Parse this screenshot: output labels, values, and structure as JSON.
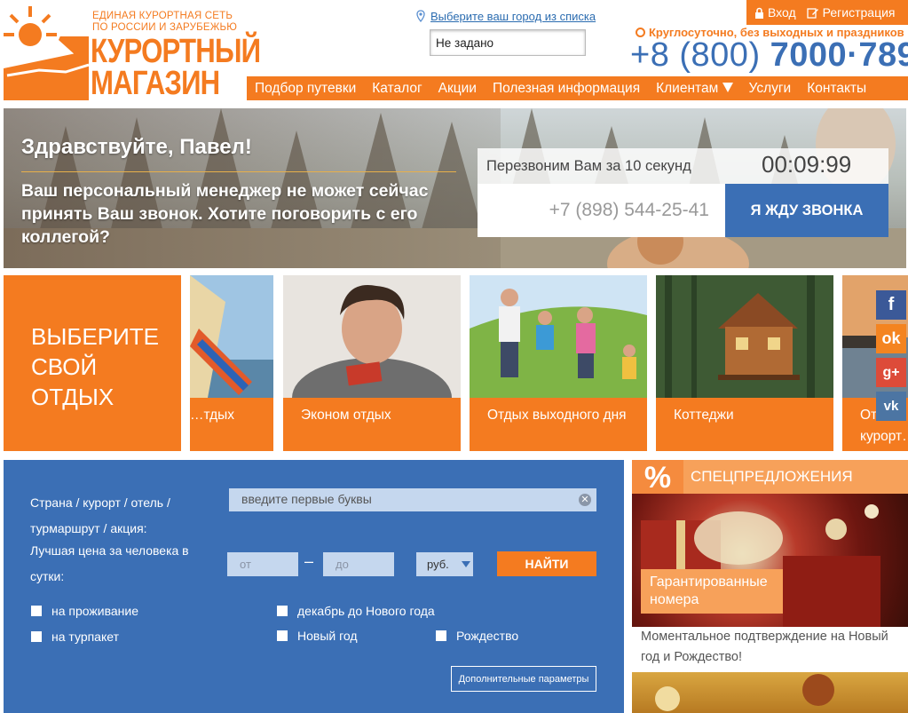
{
  "header": {
    "tagline_line1": "ЕДИНАЯ КУРОРТНАЯ СЕТЬ",
    "tagline_line2": "ПО РОССИИ И ЗАРУБЕЖЬЮ",
    "brand_line1": "КУРОРТНЫЙ",
    "brand_line2": "МАГАЗИН",
    "city_link": "Выберите ваш город из списка",
    "city_value": "Не задано",
    "login": "Вход",
    "register": "Регистрация",
    "hours": "Круглосуточно, без выходных и праздников",
    "phone_prefix": "+8 (800)",
    "phone_number": "7000·789"
  },
  "nav": {
    "items": [
      "Подбор путевки",
      "Каталог",
      "Акции",
      "Полезная информация",
      "Клиентам",
      "Услуги",
      "Контакты"
    ]
  },
  "hero": {
    "greeting": "Здравствуйте, Павел!",
    "message": "Ваш персональный менеджер не может сейчас принять Ваш звонок. Хотите поговорить с его коллегой?",
    "callback_text": "Перезвоним Вам за 10 секунд",
    "timer": "00:09:99",
    "phone_value": "+7 (898) 544-25-41",
    "callback_button": "Я ЖДУ ЗВОНКА"
  },
  "tiles": {
    "choose_title": "ВЫБЕРИТЕ СВОЙ ОТДЫХ",
    "items": [
      {
        "label": "…тдых"
      },
      {
        "label": "Эконом отдых"
      },
      {
        "label": "Отдых выходного дня"
      },
      {
        "label": "Коттеджи"
      },
      {
        "label": "От… курорт…"
      }
    ]
  },
  "social": {
    "icons": [
      "facebook-icon",
      "odnoklassniki-icon",
      "google-plus-icon",
      "vk-icon"
    ],
    "colors": [
      "#3b5998",
      "#f48420",
      "#dd4b39",
      "#4c75a3"
    ]
  },
  "search": {
    "label_destination": "Страна / курорт / отель / турмаршрут / акция:",
    "destination_placeholder": "введите первые буквы",
    "label_price": "Лучшая цена за человека в сутки:",
    "from_placeholder": "от",
    "to_placeholder": "до",
    "dash": "–",
    "currency": "руб.",
    "find_button": "НАЙТИ",
    "checkboxes": [
      "на проживание",
      "на турпакет",
      "декабрь до Нового года",
      "Новый год",
      "Рождество"
    ],
    "more_params": "Дополнительные параметры"
  },
  "special": {
    "title": "СПЕЦПРЕДЛОЖЕНИЯ",
    "percent": "%",
    "badge": "Гарантированные номера",
    "text": "Моментальное подтверждение на Новый год и Рождество!"
  },
  "colors": {
    "orange": "#f47b20",
    "blue": "#3b6fb5"
  }
}
